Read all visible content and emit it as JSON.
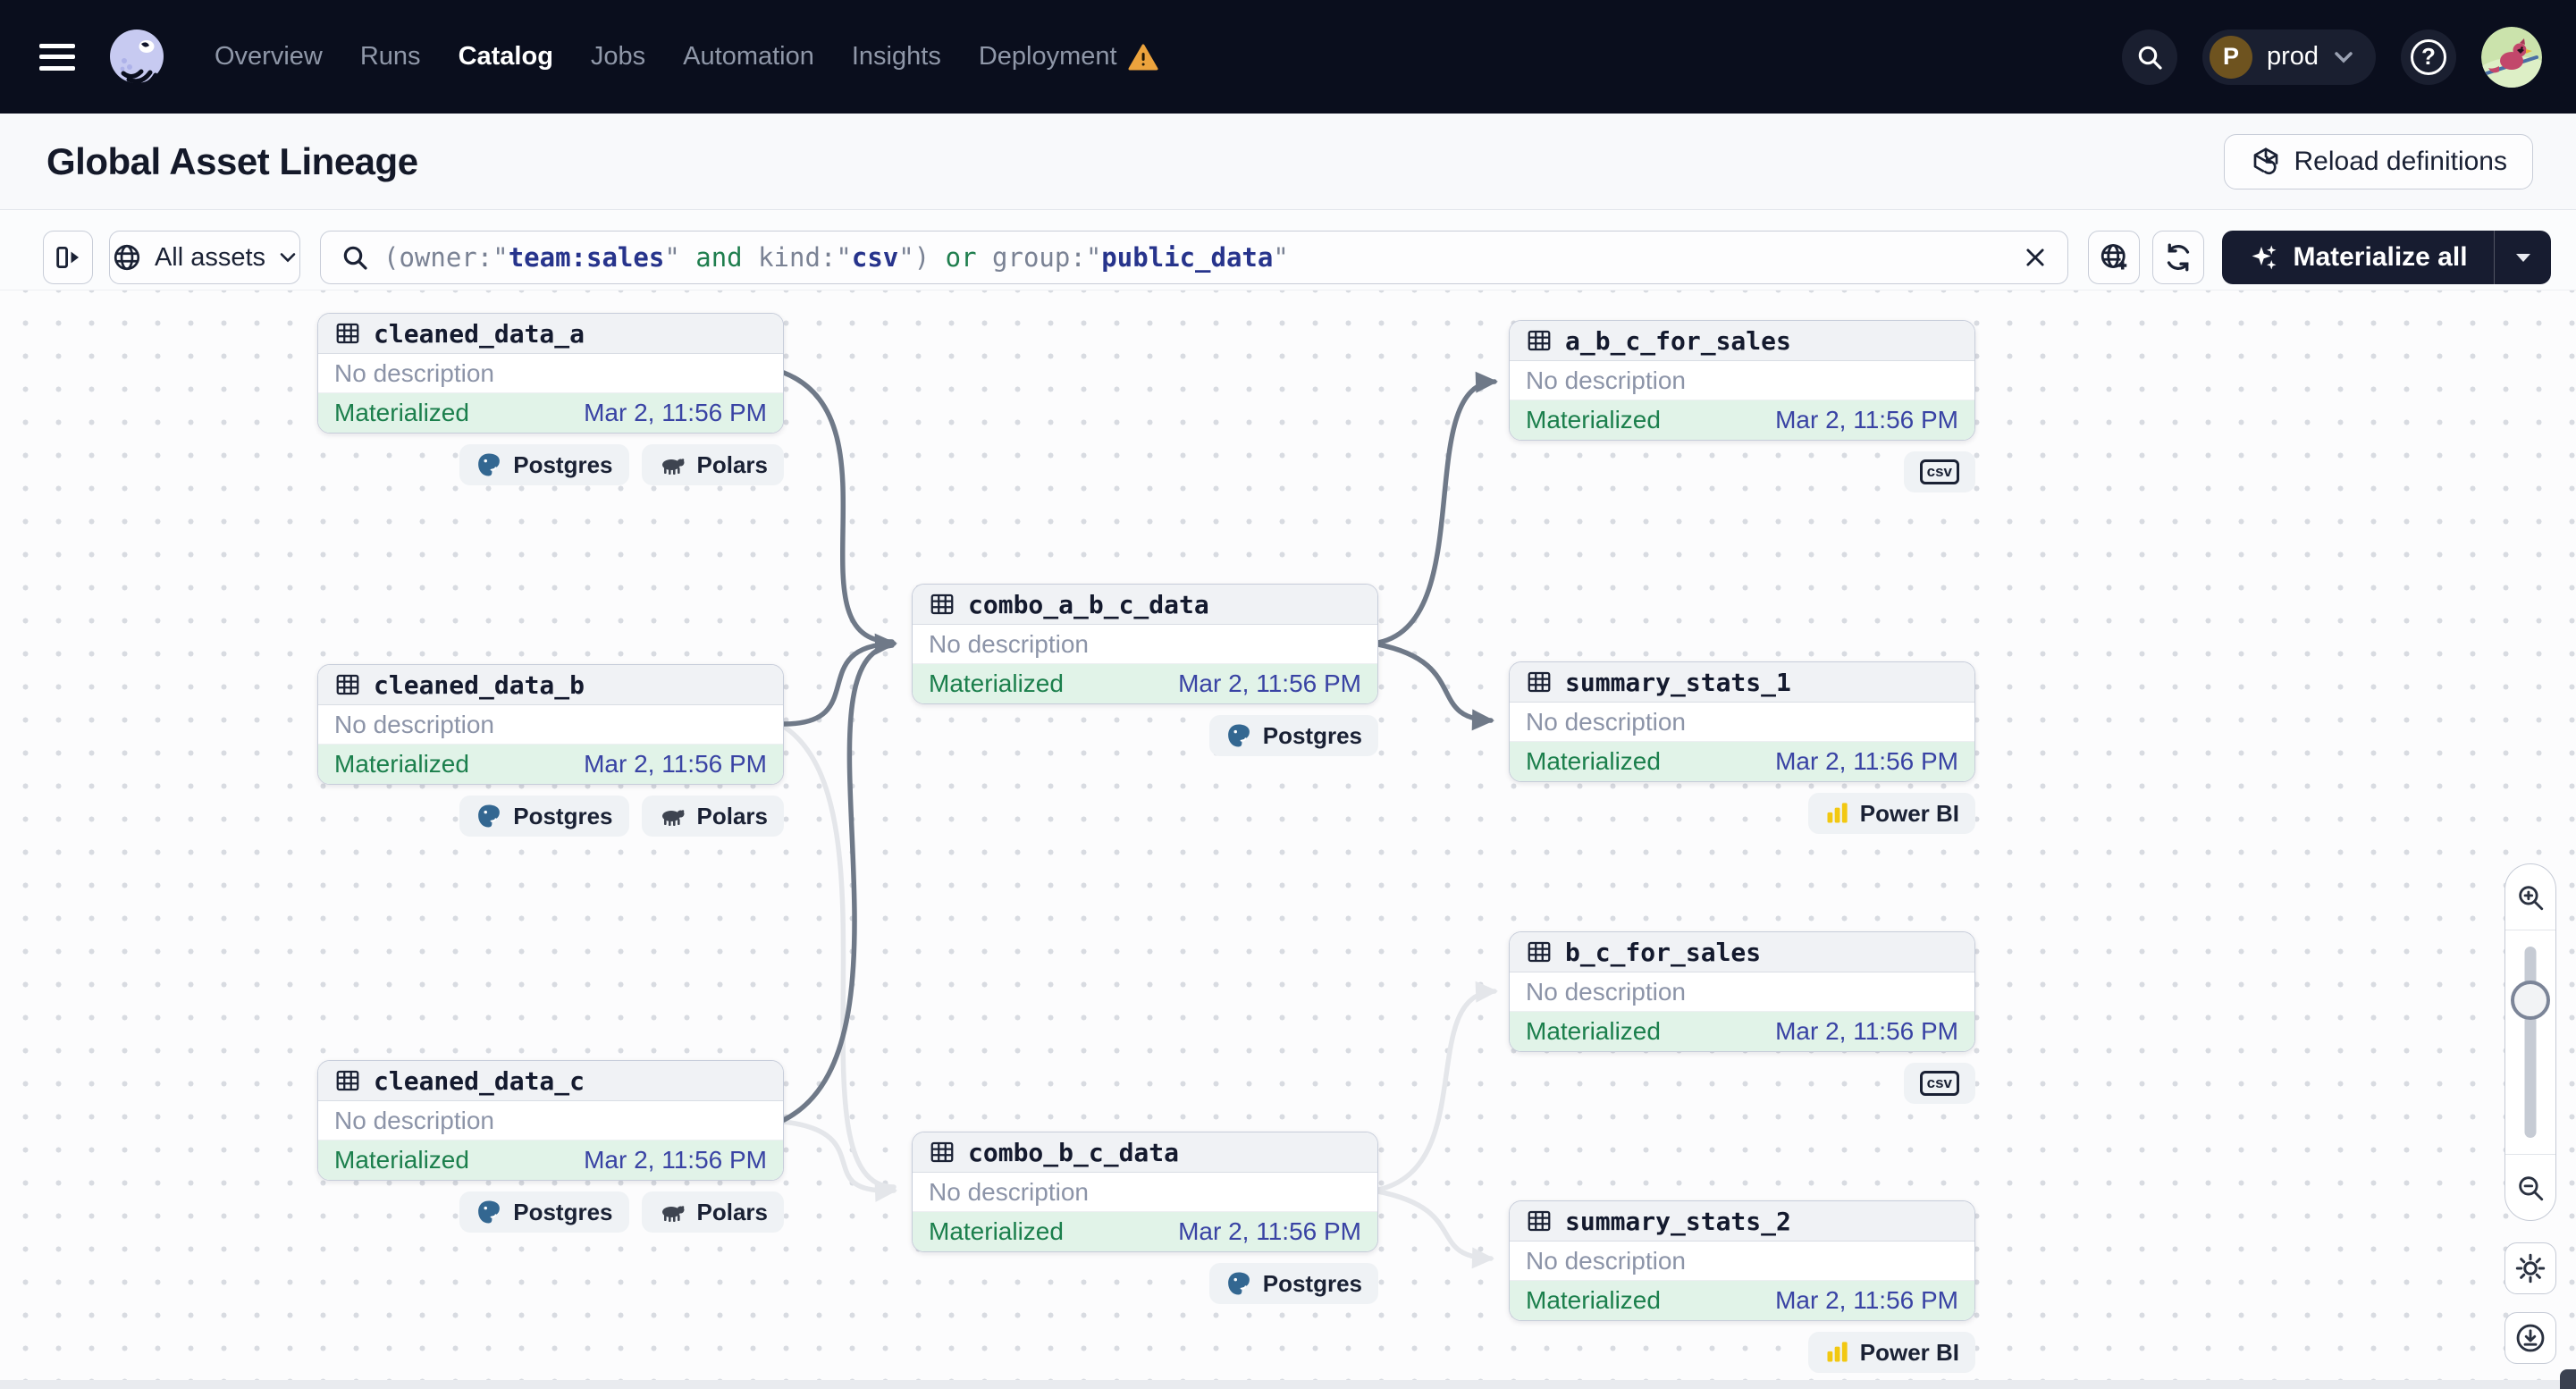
{
  "navbar": {
    "items": [
      {
        "label": "Overview"
      },
      {
        "label": "Runs"
      },
      {
        "label": "Catalog",
        "active": true
      },
      {
        "label": "Jobs"
      },
      {
        "label": "Automation"
      },
      {
        "label": "Insights"
      },
      {
        "label": "Deployment",
        "warning": true
      }
    ],
    "environment": {
      "initial": "P",
      "name": "prod"
    },
    "icons": [
      "menu-icon",
      "dagster-logo",
      "search-icon",
      "help-icon",
      "user-avatar"
    ]
  },
  "header": {
    "title": "Global Asset Lineage",
    "reload_label": "Reload definitions"
  },
  "toolbar": {
    "scope_label": "All assets",
    "query": {
      "segments": [
        "(",
        "owner:",
        "\"",
        "team:sales",
        "\"",
        " and ",
        "kind:",
        "\"",
        "csv",
        "\"",
        ")",
        " or ",
        "group:",
        "\"",
        "public_data",
        "\""
      ]
    },
    "materialize_label": "Materialize all"
  },
  "canvas": {
    "status_colors": {
      "materialized_bg": "#E1F3E8",
      "materialized_text": "#1B7F4C",
      "timestamp_text": "#3943A4"
    },
    "edge_colors": {
      "highlighted": "#6F7988",
      "dimmed": "#E4E6EA"
    },
    "nodes": [
      {
        "name": "cleaned_data_a",
        "description": "No description",
        "status": "Materialized",
        "materialized_at": "Mar 2, 11:56 PM",
        "kinds": [
          "Postgres",
          "Polars"
        ]
      },
      {
        "name": "cleaned_data_b",
        "description": "No description",
        "status": "Materialized",
        "materialized_at": "Mar 2, 11:56 PM",
        "kinds": [
          "Postgres",
          "Polars"
        ]
      },
      {
        "name": "cleaned_data_c",
        "description": "No description",
        "status": "Materialized",
        "materialized_at": "Mar 2, 11:56 PM",
        "kinds": [
          "Postgres",
          "Polars"
        ]
      },
      {
        "name": "combo_a_b_c_data",
        "description": "No description",
        "status": "Materialized",
        "materialized_at": "Mar 2, 11:56 PM",
        "kinds": [
          "Postgres"
        ]
      },
      {
        "name": "combo_b_c_data",
        "description": "No description",
        "status": "Materialized",
        "materialized_at": "Mar 2, 11:56 PM",
        "kinds": [
          "Postgres"
        ]
      },
      {
        "name": "a_b_c_for_sales",
        "description": "No description",
        "status": "Materialized",
        "materialized_at": "Mar 2, 11:56 PM",
        "kinds": [
          "csv"
        ]
      },
      {
        "name": "summary_stats_1",
        "description": "No description",
        "status": "Materialized",
        "materialized_at": "Mar 2, 11:56 PM",
        "kinds": [
          "Power BI"
        ]
      },
      {
        "name": "b_c_for_sales",
        "description": "No description",
        "status": "Materialized",
        "materialized_at": "Mar 2, 11:56 PM",
        "kinds": [
          "csv"
        ]
      },
      {
        "name": "summary_stats_2",
        "description": "No description",
        "status": "Materialized",
        "materialized_at": "Mar 2, 11:56 PM",
        "kinds": [
          "Power BI"
        ]
      }
    ]
  }
}
